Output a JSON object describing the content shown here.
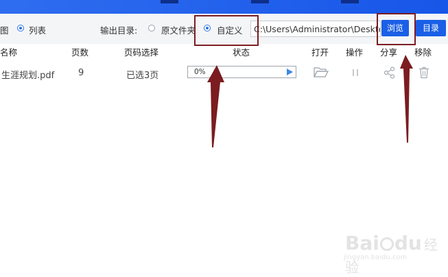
{
  "toolbar": {
    "view_label_partial": "图",
    "list_label": "列表",
    "output_dir_label": "输出目录:",
    "original_folder_label": "原文件夹",
    "custom_label": "自定义",
    "output_dir_mode": "custom",
    "path_value": "C:\\Users\\Administrator\\Desktop",
    "browse_label": "浏览",
    "directory_label": "目录"
  },
  "table": {
    "headers": {
      "name": "名称",
      "pages": "页数",
      "page_select": "页码选择",
      "status": "状态",
      "open": "打开",
      "action": "操作",
      "share": "分享",
      "remove": "移除"
    },
    "rows": [
      {
        "name": "生涯规划.pdf",
        "pages": "9",
        "page_select": "已选3页",
        "progress_text": "0%",
        "progress": 0
      }
    ]
  },
  "watermark": {
    "brand": "Bai",
    "brand2": "du",
    "brand_cn": "经验",
    "url": "jingyan.baidu.com"
  },
  "colors": {
    "topbar": "#1e5fe8",
    "accent": "#1a5fe6",
    "annotation": "#7b1c20"
  }
}
